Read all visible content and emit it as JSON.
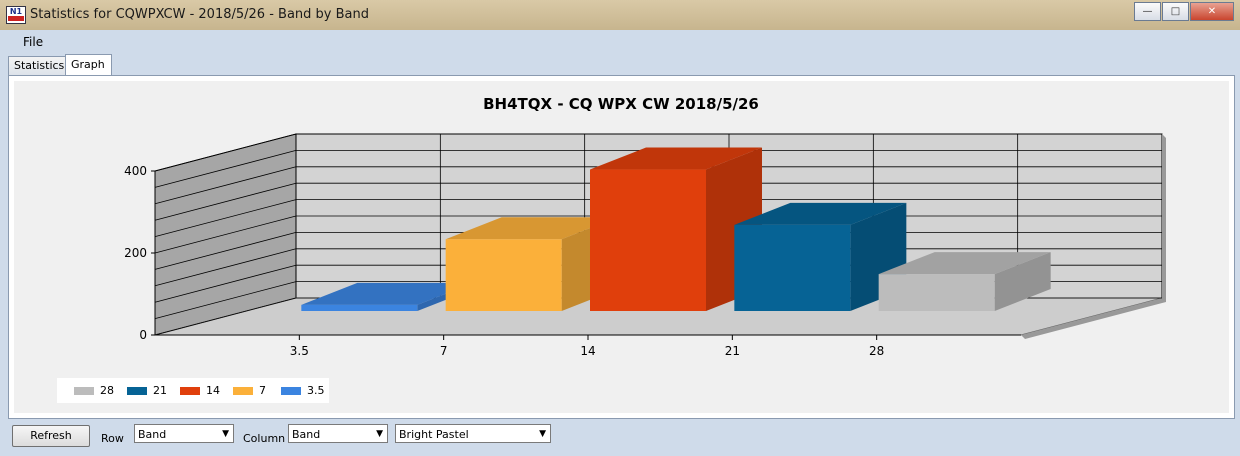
{
  "window": {
    "title": "Statistics for CQWPXCW - 2018/5/26 - Band by Band",
    "app_icon_label": "N1"
  },
  "menu": {
    "file": "File"
  },
  "tabs": [
    {
      "label": "Statistics",
      "active": false
    },
    {
      "label": "Graph",
      "active": true
    }
  ],
  "chart_data": {
    "type": "bar",
    "style": "3d",
    "title": "BH4TQX - CQ WPX  CW 2018/5/26",
    "categories": [
      "3.5",
      "7",
      "14",
      "21",
      "28"
    ],
    "values": [
      15,
      175,
      345,
      210,
      90
    ],
    "colors": [
      "#3b84e0",
      "#fbb03a",
      "#e03f0c",
      "#066395",
      "#bcbcbc"
    ],
    "ylim": [
      0,
      400
    ],
    "yticks": [
      "0",
      "200",
      "400"
    ],
    "grid": true,
    "legend": {
      "position": "bottom-left",
      "entries": [
        "28",
        "21",
        "14",
        "7",
        "3.5"
      ],
      "colors": [
        "#bcbcbc",
        "#066395",
        "#e03f0c",
        "#fbb03a",
        "#3b84e0"
      ]
    }
  },
  "controls": {
    "refresh": "Refresh",
    "row_label": "Row",
    "row_value": "Band",
    "column_label": "Column",
    "column_value": "Band",
    "palette_value": "Bright Pastel"
  }
}
